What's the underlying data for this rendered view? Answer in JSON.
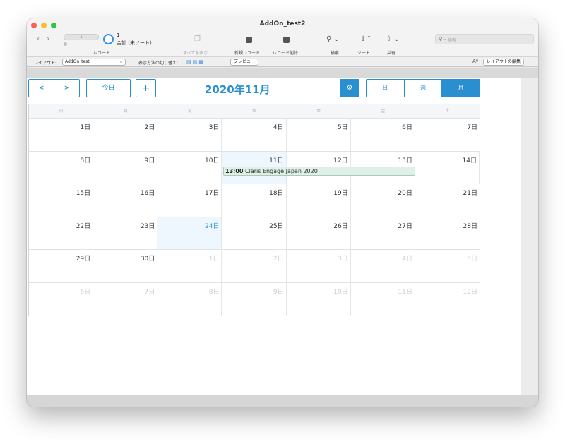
{
  "window": {
    "title": "AddOn_test2"
  },
  "toolbar": {
    "record_slider_value": "1",
    "record_count": "1",
    "record_total": "合計 (未ソート)",
    "record_label": "レコード",
    "show_all_label": "すべてを表示",
    "new_record_label": "新規レコード",
    "delete_record_label": "レコード削除",
    "find_label": "検索",
    "sort_label": "ソート",
    "share_label": "共有",
    "search_placeholder": "検索"
  },
  "layout_bar": {
    "layout_label": "レイアウト:",
    "layout_value": "AddOn_test",
    "view_switch_label": "表示方法の切り替え:",
    "preview_label": "プレビュー",
    "aa_label": "Aª",
    "edit_layout_label": "レイアウトの編集"
  },
  "calendar": {
    "title": "2020年11月",
    "prev_label": "<",
    "next_label": ">",
    "today_label": "今日",
    "add_label": "+",
    "view_day": "日",
    "view_week": "週",
    "view_month": "月",
    "weekdays": [
      "日",
      "月",
      "火",
      "水",
      "木",
      "金",
      "土"
    ],
    "weeks": [
      [
        "1日",
        "2日",
        "3日",
        "4日",
        "5日",
        "6日",
        "7日"
      ],
      [
        "8日",
        "9日",
        "10日",
        "11日",
        "12日",
        "13日",
        "14日"
      ],
      [
        "15日",
        "16日",
        "17日",
        "18日",
        "19日",
        "20日",
        "21日"
      ],
      [
        "22日",
        "23日",
        "24日",
        "25日",
        "26日",
        "27日",
        "28日"
      ],
      [
        "29日",
        "30日",
        "1日",
        "2日",
        "3日",
        "4日",
        "5日"
      ],
      [
        "6日",
        "7日",
        "8日",
        "9日",
        "10日",
        "11日",
        "12日"
      ]
    ],
    "event": {
      "time": "13:00",
      "title": "Claris Engage Japan 2020"
    }
  },
  "colors": {
    "accent": "#2a8fd1",
    "event_bg": "#dff0e6",
    "today_bg": "#eef7fd"
  }
}
